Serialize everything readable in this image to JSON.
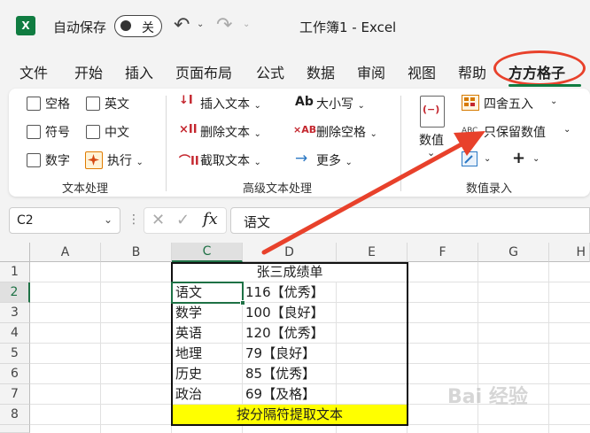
{
  "titlebar": {
    "logo_letter": "X",
    "autosave_label": "自动保存",
    "autosave_state": "关",
    "undo_icon": "↶",
    "redo_icon": "↷",
    "dropdown": "⌄",
    "doc_title": "工作簿1  -  Excel"
  },
  "tabs": [
    "文件",
    "开始",
    "插入",
    "页面布局",
    "公式",
    "数据",
    "审阅",
    "视图",
    "帮助",
    "方方格子"
  ],
  "ribbon": {
    "text_group": {
      "label": "文本处理",
      "checks": [
        "空格",
        "英文",
        "符号",
        "中文",
        "数字"
      ],
      "exec_label": "执行",
      "exec_dd": "⌄"
    },
    "adv_group": {
      "label": "高级文本处理",
      "insert_text": "插入文本",
      "delete_text": "删除文本",
      "extract_text": "截取文本",
      "case_label": "大小写",
      "case_icon": "Ab",
      "delete_space": "删除空格",
      "space_icon": "×AB",
      "more_label": "更多",
      "more_icon": "→",
      "dd": "⌄"
    },
    "num_group": {
      "label": "数值录入",
      "numeric_label": "数值",
      "numeric_icon": "(−)",
      "round_label": "四舍五入",
      "keep_values_label": "只保留数值",
      "keep_values_icon": "ABC",
      "plus": "+",
      "dd": "⌄"
    }
  },
  "formula_bar": {
    "namebox": "C2",
    "namebox_dd": "⌄",
    "more_icon": "⋮",
    "cancel_icon": "✕",
    "enter_icon": "✓",
    "fx": "fx",
    "value": "语文"
  },
  "grid": {
    "columns": [
      "A",
      "B",
      "C",
      "D",
      "E",
      "F",
      "G",
      "H"
    ],
    "rows": [
      "1",
      "2",
      "3",
      "4",
      "5",
      "6",
      "7",
      "8"
    ],
    "title": "张三成绩单",
    "subjects": [
      "语文",
      "数学",
      "英语",
      "地理",
      "历史",
      "政治"
    ],
    "scores": [
      "116【优秀】",
      "100【良好】",
      "120【优秀】",
      "79【良好】",
      "85【优秀】",
      "69【及格】"
    ],
    "footer": "按分隔符提取文本"
  },
  "watermark": "Bai 经验",
  "colors": {
    "excel_green": "#107c41",
    "highlight_red": "#e8412b",
    "footer_yellow": "#ffff00"
  }
}
